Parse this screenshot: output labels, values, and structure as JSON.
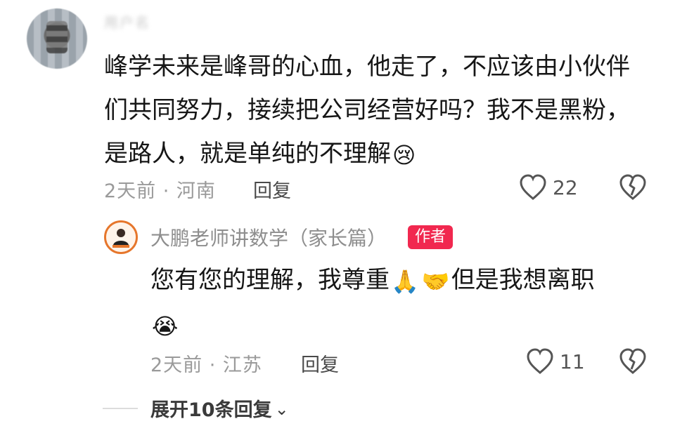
{
  "comment": {
    "username": "用户名",
    "text": "峰学未来是峰哥的心血，他走了，不应该由小伙伴们共同努力，接续把公司经营好吗？我不是黑粉，是路人，就是单纯的不理解",
    "emoji": "😢",
    "time_location": "2天前 · 河南",
    "reply_label": "回复",
    "like_count": "22"
  },
  "reply": {
    "author_name": "大鹏老师讲数学（家长篇）",
    "author_badge": "作者",
    "text_part1": "您有您的理解，我尊重",
    "emoji_pray": "🙏",
    "emoji_handshake": "🤝",
    "text_part2": "但是我想离职",
    "emoji_cry": "😭",
    "time_location": "2天前 · 江苏",
    "reply_label": "回复",
    "like_count": "11"
  },
  "expand": {
    "label": "展开10条回复"
  },
  "colors": {
    "badge": "#f1284f",
    "meta_gray": "#9a9a9a"
  }
}
